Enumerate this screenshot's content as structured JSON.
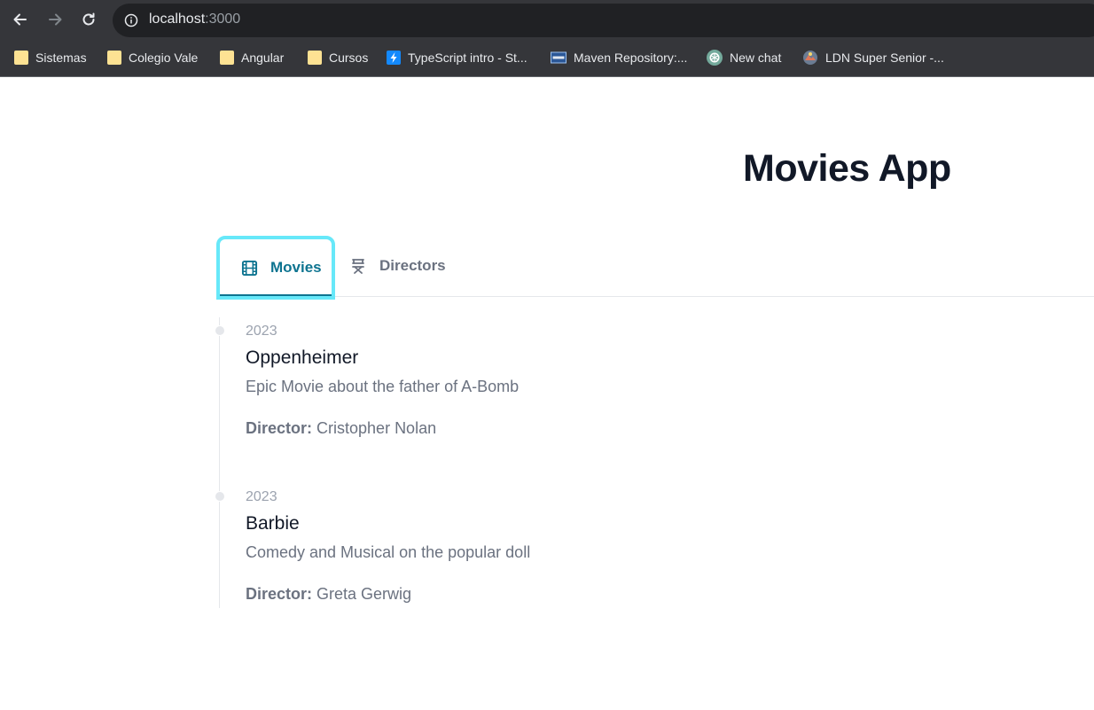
{
  "browser": {
    "url_host": "localhost",
    "url_port": ":3000",
    "bookmarks": [
      {
        "label": "Sistemas",
        "icon": "folder-icon"
      },
      {
        "label": "Colegio Vale",
        "icon": "folder-icon"
      },
      {
        "label": "Angular",
        "icon": "folder-icon"
      },
      {
        "label": "Cursos",
        "icon": "folder-icon"
      },
      {
        "label": "TypeScript intro - St...",
        "icon": "stackblitz-icon"
      },
      {
        "label": "Maven Repository:...",
        "icon": "maven-icon"
      },
      {
        "label": "New chat",
        "icon": "chatgpt-icon"
      },
      {
        "label": "LDN Super Senior -...",
        "icon": "ldn-icon"
      }
    ]
  },
  "page": {
    "title": "Movies App",
    "tabs": [
      {
        "label": "Movies",
        "icon": "film-icon",
        "active": true
      },
      {
        "label": "Directors",
        "icon": "director-chair-icon",
        "active": false
      }
    ],
    "director_label": "Director:",
    "movies": [
      {
        "year": "2023",
        "title": "Oppenheimer",
        "description": "Epic Movie about the father of A-Bomb",
        "director": "Cristopher Nolan"
      },
      {
        "year": "2023",
        "title": "Barbie",
        "description": "Comedy and Musical on the popular doll",
        "director": "Greta Gerwig"
      }
    ]
  },
  "colors": {
    "accent": "#0e7490",
    "focus_ring": "#67e8f9",
    "heading": "#111827",
    "muted": "#6b7280",
    "chrome_bg": "#35363a",
    "omnibox_bg": "#202124"
  }
}
